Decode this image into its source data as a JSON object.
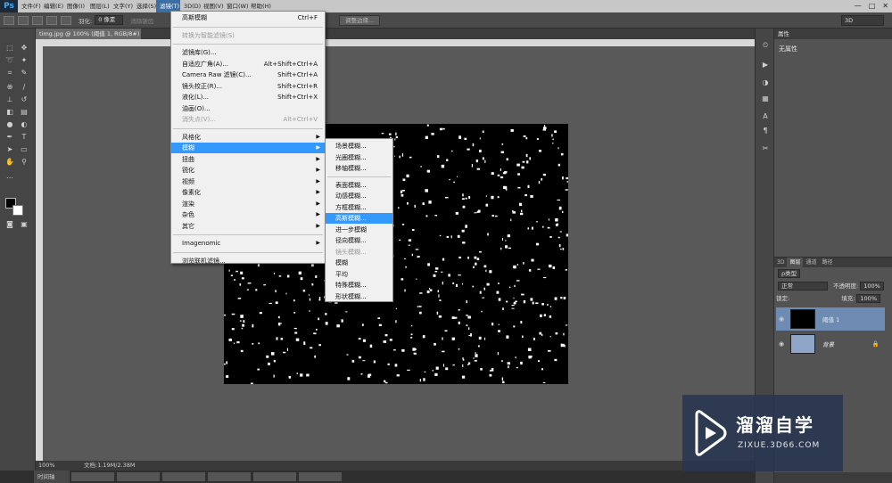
{
  "app": {
    "logo": "Ps"
  },
  "menubar": [
    {
      "label": "文件(F)",
      "w": 25
    },
    {
      "label": "编辑(E)",
      "w": 26
    },
    {
      "label": "图像(I)",
      "w": 26
    },
    {
      "label": "图层(L)",
      "w": 26
    },
    {
      "label": "文字(Y)",
      "w": 26
    },
    {
      "label": "选择(S)",
      "w": 26
    },
    {
      "label": "滤镜(T)",
      "w": 27,
      "active": true
    },
    {
      "label": "3D(D)",
      "w": 22
    },
    {
      "label": "视图(V)",
      "w": 26
    },
    {
      "label": "窗口(W)",
      "w": 27
    },
    {
      "label": "帮助(H)",
      "w": 26
    }
  ],
  "window_controls": [
    "—",
    "□",
    "✕"
  ],
  "options_bar": {
    "feather_label": "羽化:",
    "feather_value": "0 像素",
    "antialias_label": "消除锯齿",
    "adjust_edge": "调整边缘...",
    "workspace": "3D"
  },
  "document": {
    "tab_title": "timg.jpg @ 100% (阈值 1, RGB/8#) *",
    "zoom": "100%",
    "doc_info": "文档:1.19M/2.38M"
  },
  "timeline_label": "时间轴",
  "filter_menu": {
    "items": [
      {
        "label": "高斯模糊",
        "shortcut": "Ctrl+F",
        "type": "item"
      },
      {
        "type": "sep"
      },
      {
        "label": "转换为智能滤镜(S)",
        "type": "item",
        "disabled": true
      },
      {
        "type": "sep"
      },
      {
        "label": "滤镜库(G)...",
        "type": "item"
      },
      {
        "label": "自适应广角(A)...",
        "shortcut": "Alt+Shift+Ctrl+A",
        "type": "item"
      },
      {
        "label": "Camera Raw 滤镜(C)...",
        "shortcut": "Shift+Ctrl+A",
        "type": "item"
      },
      {
        "label": "镜头校正(R)...",
        "shortcut": "Shift+Ctrl+R",
        "type": "item"
      },
      {
        "label": "液化(L)...",
        "shortcut": "Shift+Ctrl+X",
        "type": "item"
      },
      {
        "label": "油画(O)...",
        "type": "item"
      },
      {
        "label": "消失点(V)...",
        "shortcut": "Alt+Ctrl+V",
        "type": "item",
        "disabled": true
      },
      {
        "type": "sep"
      },
      {
        "label": "风格化",
        "type": "sub"
      },
      {
        "label": "模糊",
        "type": "sub",
        "highlight": true
      },
      {
        "label": "扭曲",
        "type": "sub"
      },
      {
        "label": "锐化",
        "type": "sub"
      },
      {
        "label": "视频",
        "type": "sub"
      },
      {
        "label": "像素化",
        "type": "sub"
      },
      {
        "label": "渲染",
        "type": "sub"
      },
      {
        "label": "杂色",
        "type": "sub"
      },
      {
        "label": "其它",
        "type": "sub"
      },
      {
        "type": "sep"
      },
      {
        "label": "Imagenomic",
        "type": "sub"
      },
      {
        "type": "sep"
      },
      {
        "label": "浏览联机滤镜...",
        "type": "item"
      }
    ]
  },
  "blur_menu": {
    "items": [
      {
        "label": "场景模糊...",
        "type": "item"
      },
      {
        "label": "光圈模糊...",
        "type": "item"
      },
      {
        "label": "移轴模糊...",
        "type": "item"
      },
      {
        "type": "sep"
      },
      {
        "label": "表面模糊...",
        "type": "item"
      },
      {
        "label": "动感模糊...",
        "type": "item"
      },
      {
        "label": "方框模糊...",
        "type": "item"
      },
      {
        "label": "高斯模糊...",
        "type": "item",
        "highlight": true
      },
      {
        "label": "进一步模糊",
        "type": "item"
      },
      {
        "label": "径向模糊...",
        "type": "item"
      },
      {
        "label": "镜头模糊...",
        "type": "item",
        "disabled": true
      },
      {
        "label": "模糊",
        "type": "item"
      },
      {
        "label": "平均",
        "type": "item"
      },
      {
        "label": "特殊模糊...",
        "type": "item"
      },
      {
        "label": "形状模糊...",
        "type": "item"
      }
    ]
  },
  "properties_panel": {
    "title": "属性",
    "body": "无属性"
  },
  "layers_panel": {
    "tabs": [
      "3D",
      "图层",
      "通道",
      "路径"
    ],
    "kind": "ρ类型",
    "blend_mode": "正常",
    "opacity_label": "不透明度:",
    "opacity": "100%",
    "lock_label": "锁定:",
    "fill_label": "填充:",
    "fill": "100%",
    "layers": [
      {
        "name": "阈值 1",
        "active": true
      },
      {
        "name": "背景",
        "active": false
      }
    ]
  },
  "watermark": {
    "title": "溜溜自学",
    "url": "ZIXUE.3D66.COM"
  },
  "icons": {
    "tools": [
      "marquee-icon",
      "move-icon",
      "lasso-icon",
      "magic-wand-icon",
      "crop-icon",
      "eyedropper-icon",
      "healing-icon",
      "brush-icon",
      "stamp-icon",
      "history-brush-icon",
      "eraser-icon",
      "gradient-icon",
      "blur-tool-icon",
      "dodge-icon",
      "pen-icon",
      "type-icon",
      "path-select-icon",
      "shape-icon",
      "hand-icon",
      "zoom-icon"
    ],
    "dock": [
      "history-icon",
      "actions-icon",
      "adjust-icon",
      "swatch-icon",
      "character-icon",
      "paragraph-icon",
      "tools-preset-icon"
    ]
  }
}
